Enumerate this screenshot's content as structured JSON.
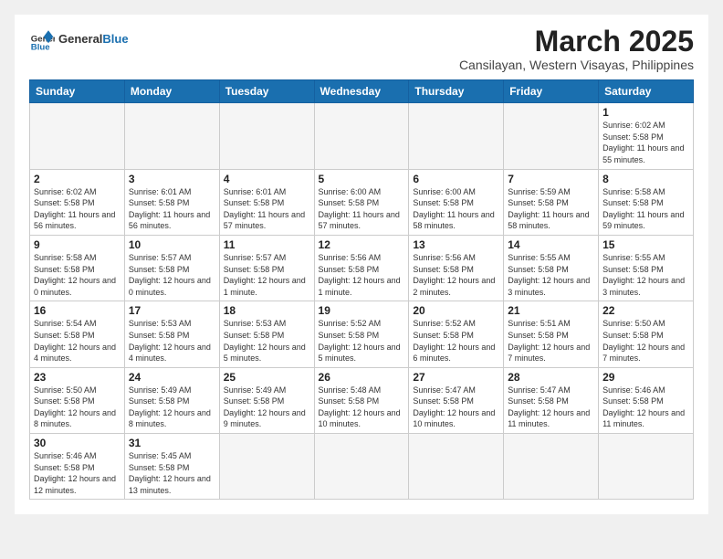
{
  "header": {
    "logo_general": "General",
    "logo_blue": "Blue",
    "month_title": "March 2025",
    "location": "Cansilayan, Western Visayas, Philippines"
  },
  "days_of_week": [
    "Sunday",
    "Monday",
    "Tuesday",
    "Wednesday",
    "Thursday",
    "Friday",
    "Saturday"
  ],
  "weeks": [
    [
      {
        "day": "",
        "info": ""
      },
      {
        "day": "",
        "info": ""
      },
      {
        "day": "",
        "info": ""
      },
      {
        "day": "",
        "info": ""
      },
      {
        "day": "",
        "info": ""
      },
      {
        "day": "",
        "info": ""
      },
      {
        "day": "1",
        "info": "Sunrise: 6:02 AM\nSunset: 5:58 PM\nDaylight: 11 hours\nand 55 minutes."
      }
    ],
    [
      {
        "day": "2",
        "info": "Sunrise: 6:02 AM\nSunset: 5:58 PM\nDaylight: 11 hours\nand 56 minutes."
      },
      {
        "day": "3",
        "info": "Sunrise: 6:01 AM\nSunset: 5:58 PM\nDaylight: 11 hours\nand 56 minutes."
      },
      {
        "day": "4",
        "info": "Sunrise: 6:01 AM\nSunset: 5:58 PM\nDaylight: 11 hours\nand 57 minutes."
      },
      {
        "day": "5",
        "info": "Sunrise: 6:00 AM\nSunset: 5:58 PM\nDaylight: 11 hours\nand 57 minutes."
      },
      {
        "day": "6",
        "info": "Sunrise: 6:00 AM\nSunset: 5:58 PM\nDaylight: 11 hours\nand 58 minutes."
      },
      {
        "day": "7",
        "info": "Sunrise: 5:59 AM\nSunset: 5:58 PM\nDaylight: 11 hours\nand 58 minutes."
      },
      {
        "day": "8",
        "info": "Sunrise: 5:58 AM\nSunset: 5:58 PM\nDaylight: 11 hours\nand 59 minutes."
      }
    ],
    [
      {
        "day": "9",
        "info": "Sunrise: 5:58 AM\nSunset: 5:58 PM\nDaylight: 12 hours\nand 0 minutes."
      },
      {
        "day": "10",
        "info": "Sunrise: 5:57 AM\nSunset: 5:58 PM\nDaylight: 12 hours\nand 0 minutes."
      },
      {
        "day": "11",
        "info": "Sunrise: 5:57 AM\nSunset: 5:58 PM\nDaylight: 12 hours\nand 1 minute."
      },
      {
        "day": "12",
        "info": "Sunrise: 5:56 AM\nSunset: 5:58 PM\nDaylight: 12 hours\nand 1 minute."
      },
      {
        "day": "13",
        "info": "Sunrise: 5:56 AM\nSunset: 5:58 PM\nDaylight: 12 hours\nand 2 minutes."
      },
      {
        "day": "14",
        "info": "Sunrise: 5:55 AM\nSunset: 5:58 PM\nDaylight: 12 hours\nand 3 minutes."
      },
      {
        "day": "15",
        "info": "Sunrise: 5:55 AM\nSunset: 5:58 PM\nDaylight: 12 hours\nand 3 minutes."
      }
    ],
    [
      {
        "day": "16",
        "info": "Sunrise: 5:54 AM\nSunset: 5:58 PM\nDaylight: 12 hours\nand 4 minutes."
      },
      {
        "day": "17",
        "info": "Sunrise: 5:53 AM\nSunset: 5:58 PM\nDaylight: 12 hours\nand 4 minutes."
      },
      {
        "day": "18",
        "info": "Sunrise: 5:53 AM\nSunset: 5:58 PM\nDaylight: 12 hours\nand 5 minutes."
      },
      {
        "day": "19",
        "info": "Sunrise: 5:52 AM\nSunset: 5:58 PM\nDaylight: 12 hours\nand 5 minutes."
      },
      {
        "day": "20",
        "info": "Sunrise: 5:52 AM\nSunset: 5:58 PM\nDaylight: 12 hours\nand 6 minutes."
      },
      {
        "day": "21",
        "info": "Sunrise: 5:51 AM\nSunset: 5:58 PM\nDaylight: 12 hours\nand 7 minutes."
      },
      {
        "day": "22",
        "info": "Sunrise: 5:50 AM\nSunset: 5:58 PM\nDaylight: 12 hours\nand 7 minutes."
      }
    ],
    [
      {
        "day": "23",
        "info": "Sunrise: 5:50 AM\nSunset: 5:58 PM\nDaylight: 12 hours\nand 8 minutes."
      },
      {
        "day": "24",
        "info": "Sunrise: 5:49 AM\nSunset: 5:58 PM\nDaylight: 12 hours\nand 8 minutes."
      },
      {
        "day": "25",
        "info": "Sunrise: 5:49 AM\nSunset: 5:58 PM\nDaylight: 12 hours\nand 9 minutes."
      },
      {
        "day": "26",
        "info": "Sunrise: 5:48 AM\nSunset: 5:58 PM\nDaylight: 12 hours\nand 10 minutes."
      },
      {
        "day": "27",
        "info": "Sunrise: 5:47 AM\nSunset: 5:58 PM\nDaylight: 12 hours\nand 10 minutes."
      },
      {
        "day": "28",
        "info": "Sunrise: 5:47 AM\nSunset: 5:58 PM\nDaylight: 12 hours\nand 11 minutes."
      },
      {
        "day": "29",
        "info": "Sunrise: 5:46 AM\nSunset: 5:58 PM\nDaylight: 12 hours\nand 11 minutes."
      }
    ],
    [
      {
        "day": "30",
        "info": "Sunrise: 5:46 AM\nSunset: 5:58 PM\nDaylight: 12 hours\nand 12 minutes."
      },
      {
        "day": "31",
        "info": "Sunrise: 5:45 AM\nSunset: 5:58 PM\nDaylight: 12 hours\nand 13 minutes."
      },
      {
        "day": "",
        "info": ""
      },
      {
        "day": "",
        "info": ""
      },
      {
        "day": "",
        "info": ""
      },
      {
        "day": "",
        "info": ""
      },
      {
        "day": "",
        "info": ""
      }
    ]
  ]
}
